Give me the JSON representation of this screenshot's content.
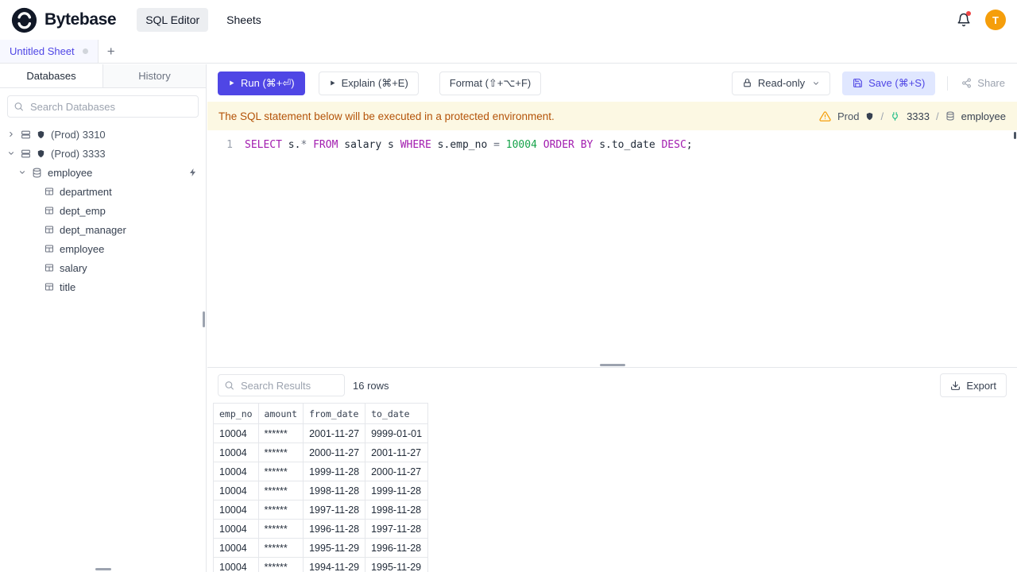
{
  "topbar": {
    "brand": "Bytebase",
    "nav": [
      {
        "label": "SQL Editor"
      },
      {
        "label": "Sheets"
      }
    ],
    "avatar": "T"
  },
  "sheetbar": {
    "tab": "Untitled Sheet",
    "add": "+"
  },
  "sidebar": {
    "tabs": [
      {
        "label": "Databases"
      },
      {
        "label": "History"
      }
    ],
    "search_placeholder": "Search Databases",
    "tree": [
      {
        "type": "instance",
        "label": "(Prod) 3310"
      },
      {
        "type": "instance",
        "label": "(Prod) 3333"
      },
      {
        "type": "database",
        "label": "employee"
      },
      {
        "type": "table",
        "label": "department"
      },
      {
        "type": "table",
        "label": "dept_emp"
      },
      {
        "type": "table",
        "label": "dept_manager"
      },
      {
        "type": "table",
        "label": "employee"
      },
      {
        "type": "table",
        "label": "salary"
      },
      {
        "type": "table",
        "label": "title"
      }
    ]
  },
  "toolbar": {
    "run": "Run (⌘+⏎)",
    "explain": "Explain (⌘+E)",
    "format": "Format (⇧+⌥+F)",
    "readonly": "Read-only",
    "save": "Save (⌘+S)",
    "share": "Share"
  },
  "notice": {
    "message": "The SQL statement below will be executed in a protected environment.",
    "environment": "Prod",
    "separator": "/",
    "instance": "3333",
    "database": "employee"
  },
  "editor": {
    "line_number": "1",
    "tokens": [
      {
        "text": "SELECT",
        "type": "keyword"
      },
      {
        "text": " s.",
        "type": "plain"
      },
      {
        "text": "*",
        "type": "operator"
      },
      {
        "text": " ",
        "type": "plain"
      },
      {
        "text": "FROM",
        "type": "keyword"
      },
      {
        "text": " salary s ",
        "type": "plain"
      },
      {
        "text": "WHERE",
        "type": "keyword"
      },
      {
        "text": " s.emp_no ",
        "type": "plain"
      },
      {
        "text": "=",
        "type": "operator"
      },
      {
        "text": " ",
        "type": "plain"
      },
      {
        "text": "10004",
        "type": "number"
      },
      {
        "text": " ",
        "type": "plain"
      },
      {
        "text": "ORDER BY",
        "type": "keyword"
      },
      {
        "text": " s.to_date ",
        "type": "plain"
      },
      {
        "text": "DESC",
        "type": "keyword"
      },
      {
        "text": ";",
        "type": "plain"
      }
    ]
  },
  "results": {
    "search_placeholder": "Search Results",
    "row_count": "16 rows",
    "export": "Export",
    "columns": [
      "emp_no",
      "amount",
      "from_date",
      "to_date"
    ],
    "rows": [
      [
        "10004",
        "******",
        "2001-11-27",
        "9999-01-01"
      ],
      [
        "10004",
        "******",
        "2000-11-27",
        "2001-11-27"
      ],
      [
        "10004",
        "******",
        "1999-11-28",
        "2000-11-27"
      ],
      [
        "10004",
        "******",
        "1998-11-28",
        "1999-11-28"
      ],
      [
        "10004",
        "******",
        "1997-11-28",
        "1998-11-28"
      ],
      [
        "10004",
        "******",
        "1996-11-28",
        "1997-11-28"
      ],
      [
        "10004",
        "******",
        "1995-11-29",
        "1996-11-28"
      ],
      [
        "10004",
        "******",
        "1994-11-29",
        "1995-11-29"
      ]
    ]
  },
  "colors": {
    "accent": "#4f46e5",
    "keyword": "#a21caf",
    "number": "#16a34a",
    "notice_bg": "#fcf8e3",
    "avatar_bg": "#f59e0b"
  }
}
